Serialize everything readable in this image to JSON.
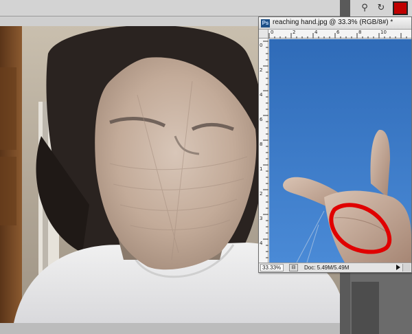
{
  "document": {
    "title": "reaching hand.jpg @ 33.3% (RGB/8#) *",
    "zoom": "33.33%",
    "doc_size": "Doc: 5.49M/5.49M",
    "ruler_h_labels": [
      "0",
      "2",
      "4",
      "6",
      "8",
      "10"
    ],
    "ruler_v_labels": [
      "0",
      "2",
      "4",
      "6",
      "8",
      "1",
      "2",
      "3",
      "4"
    ]
  },
  "panel": {
    "swatch_color": "#c00000",
    "tool_1_icon": "puppet-pin-icon",
    "tool_2_icon": "rotate-icon"
  },
  "colors": {
    "sky": "#3f7fc9",
    "annotation": "#e00000",
    "skin": "#cdb7a6"
  }
}
